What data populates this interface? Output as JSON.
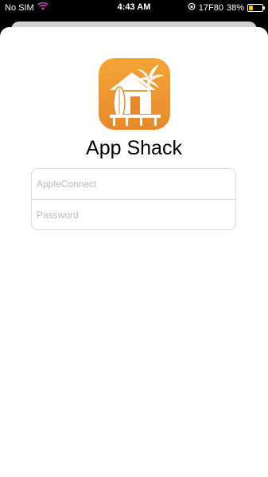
{
  "status_bar": {
    "carrier": "No SIM",
    "time": "4:43 AM",
    "right_text": "17F80",
    "battery_percent": "38%",
    "battery_level": 0.38,
    "battery_color": "#f5c400"
  },
  "app": {
    "name": "App Shack",
    "icon": "beach-hut-icon",
    "icon_gradient": [
      "#f3a535",
      "#e8892c"
    ]
  },
  "login": {
    "username_placeholder": "AppleConnect",
    "password_placeholder": "Password"
  }
}
